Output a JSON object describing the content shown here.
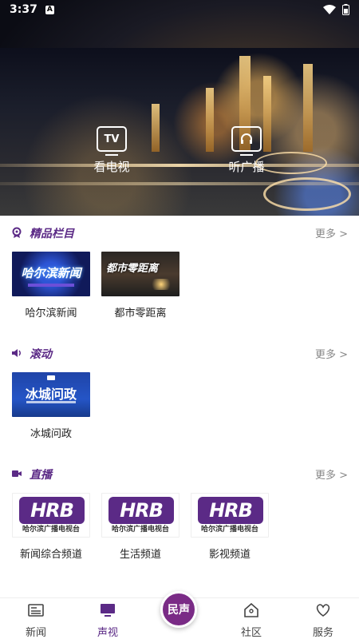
{
  "status_bar": {
    "time": "3:37",
    "notif_badge": "A"
  },
  "hero": {
    "watch_tv": {
      "icon_text": "TV",
      "label": "看电视"
    },
    "listen_radio": {
      "label": "听广播"
    }
  },
  "sections": {
    "featured": {
      "title": "精品栏目",
      "more": "更多 >",
      "items": [
        {
          "label": "哈尔滨新闻",
          "thumb_text": "哈尔滨新闻"
        },
        {
          "label": "都市零距离",
          "thumb_text": "都市零距离"
        }
      ]
    },
    "rolling": {
      "title": "滚动",
      "more": "更多 >",
      "items": [
        {
          "label": "冰城问政",
          "thumb_text": "冰城问政"
        }
      ]
    },
    "live": {
      "title": "直播",
      "more": "更多 >",
      "logo_text": "HRB",
      "station_name": "哈尔滨广播电视台",
      "items": [
        {
          "label": "新闻综合频道"
        },
        {
          "label": "生活频道"
        },
        {
          "label": "影视频道"
        }
      ]
    }
  },
  "bottom_nav": {
    "news": "新闻",
    "audio_video": "声视",
    "center": "民声",
    "community": "社区",
    "service": "服务"
  },
  "colors": {
    "brand_purple": "#5b2a86",
    "center_button": "#7a2b86"
  }
}
